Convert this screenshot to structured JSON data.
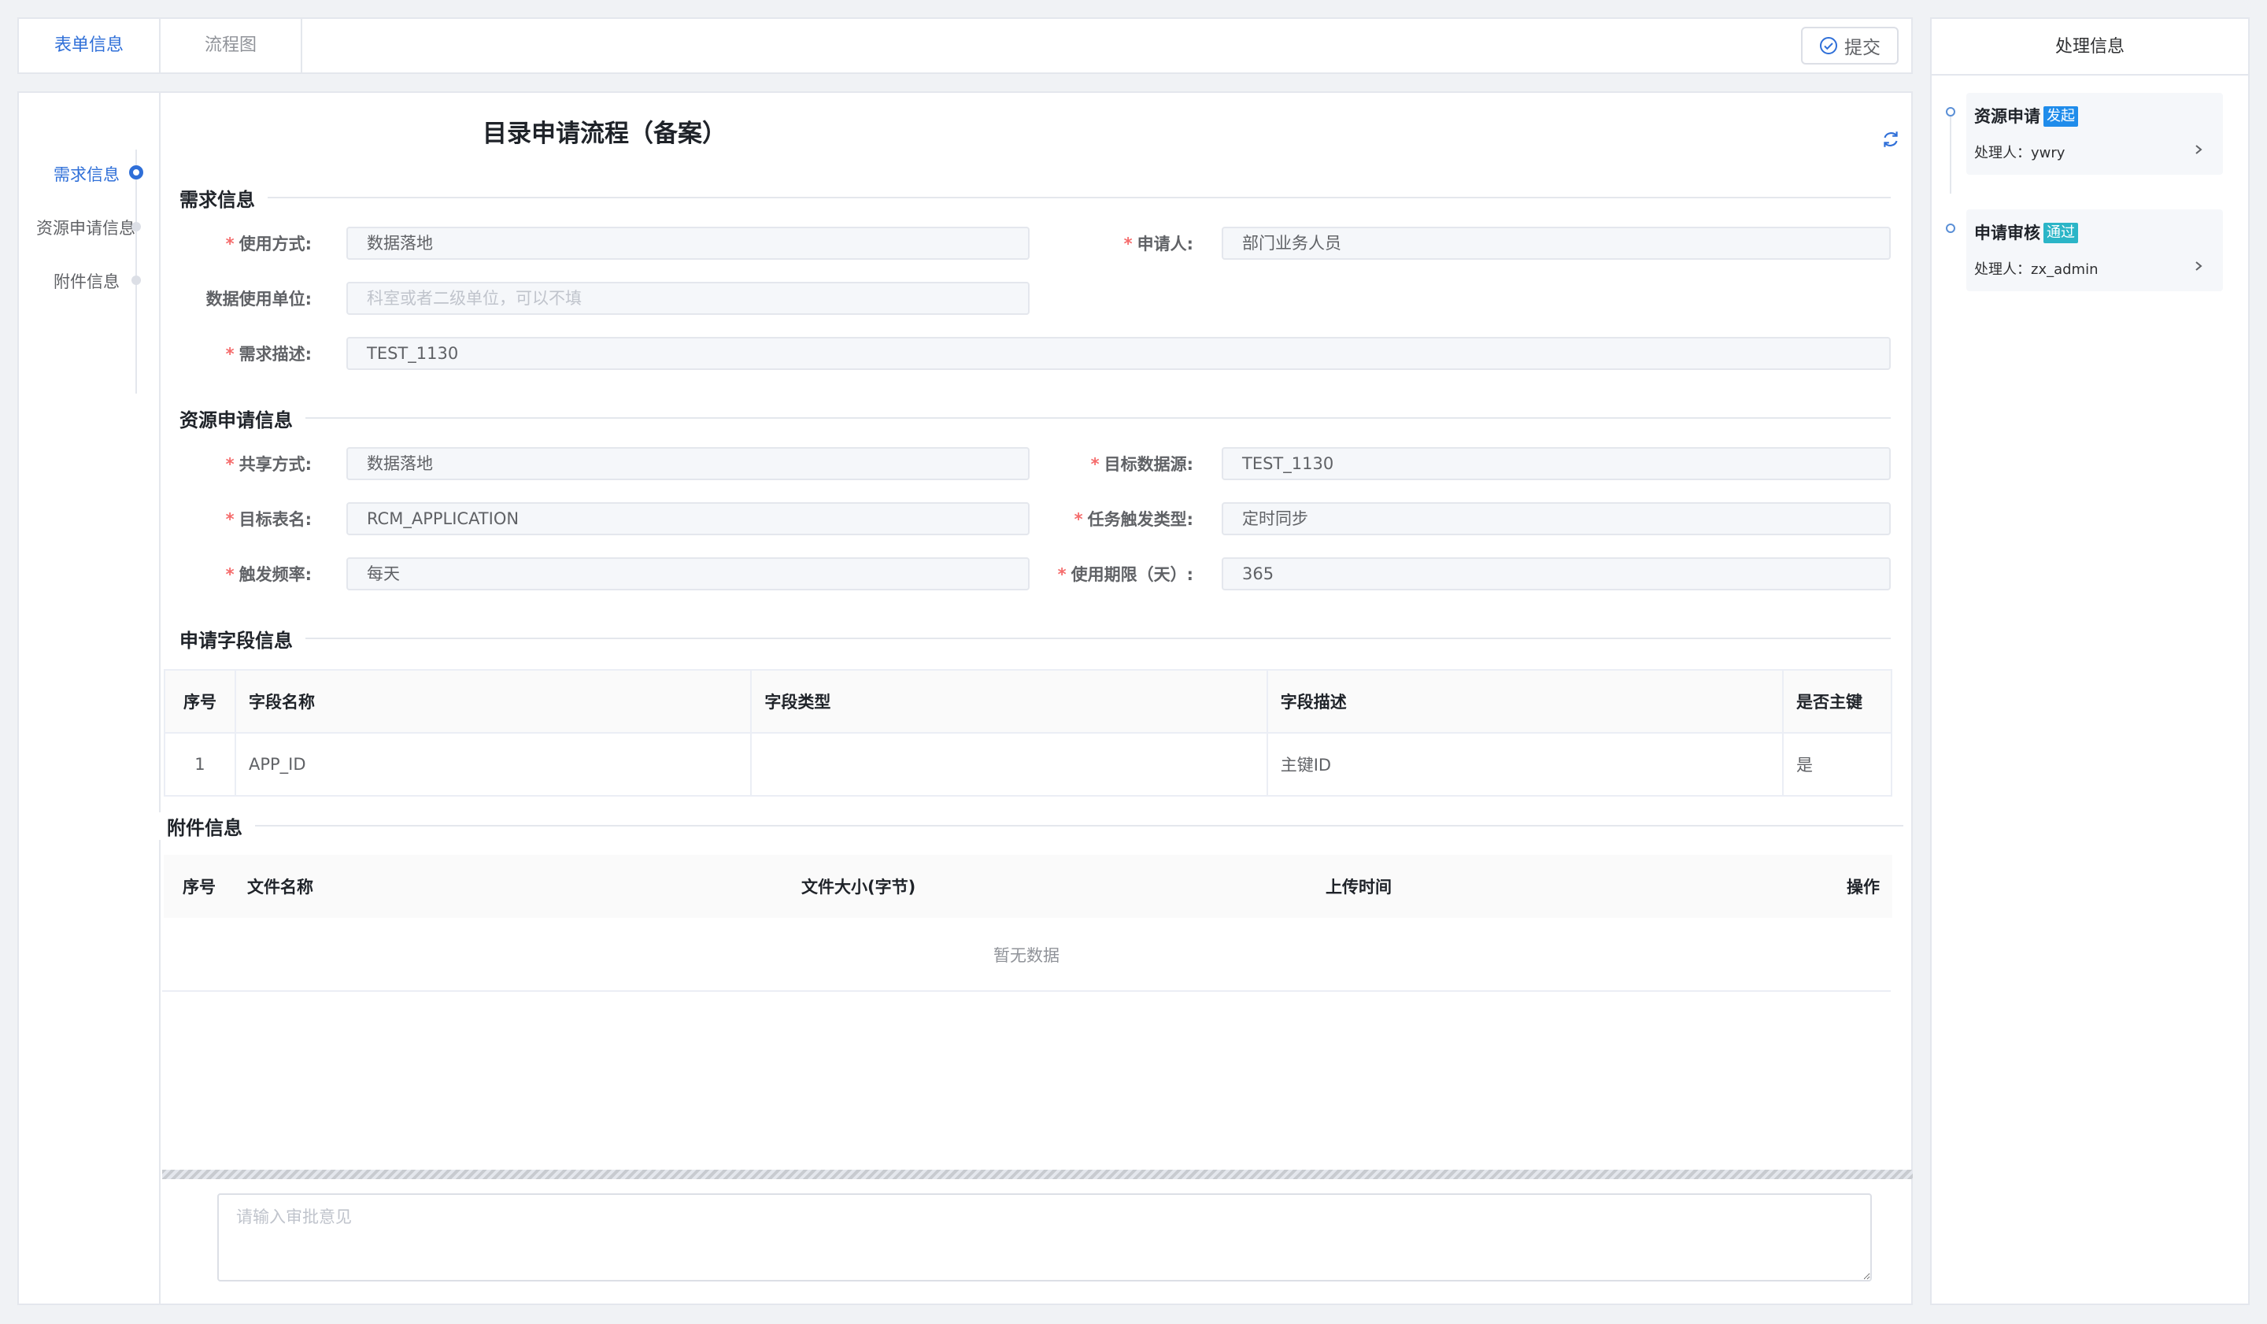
{
  "tabs": [
    {
      "label": "表单信息",
      "active": true
    },
    {
      "label": "流程图",
      "active": false
    }
  ],
  "toolbar": {
    "submit_label": "提交",
    "submit_icon": "check-circle-icon"
  },
  "anchors": [
    {
      "label": "需求信息",
      "active": true
    },
    {
      "label": "资源申请信息",
      "active": false
    },
    {
      "label": "附件信息",
      "active": false
    }
  ],
  "form": {
    "title": "目录申请流程（备案）",
    "sections": {
      "demand": "需求信息",
      "resource": "资源申请信息",
      "fields": "申请字段信息",
      "attachments": "附件信息"
    },
    "demand": {
      "usage_mode": {
        "label": "使用方式:",
        "value": "数据落地",
        "required": true
      },
      "applicant": {
        "label": "申请人:",
        "value": "部门业务人员",
        "required": true
      },
      "using_unit": {
        "label": "数据使用单位:",
        "placeholder": "科室或者二级单位，可以不填",
        "required": false
      },
      "description": {
        "label": "需求描述:",
        "value": "TEST_1130",
        "required": true
      }
    },
    "resource": {
      "share_mode": {
        "label": "共享方式:",
        "value": "数据落地"
      },
      "target_datasource": {
        "label": "目标数据源:",
        "value": "TEST_1130"
      },
      "target_table": {
        "label": "目标表名:",
        "value": "RCM_APPLICATION"
      },
      "trigger_type": {
        "label": "任务触发类型:",
        "value": "定时同步"
      },
      "trigger_freq": {
        "label": "触发频率:",
        "value": "每天"
      },
      "usage_period": {
        "label": "使用期限（天）:",
        "value": "365"
      }
    },
    "field_table": {
      "headers": [
        "序号",
        "字段名称",
        "字段类型",
        "字段描述",
        "是否主键"
      ],
      "rows": [
        [
          "1",
          "APP_ID",
          "",
          "主键ID",
          "是"
        ]
      ]
    },
    "attachment_table": {
      "headers": [
        "序号",
        "文件名称",
        "文件大小(字节)",
        "上传时间",
        "操作"
      ],
      "empty_text": "暂无数据"
    },
    "opinion_placeholder": "请输入审批意见"
  },
  "side": {
    "title": "处理信息",
    "steps": [
      {
        "title": "资源申请",
        "badge": "发起",
        "badge_color": "#1f8ceb",
        "handler": "处理人：ywry"
      },
      {
        "title": "申请审核",
        "badge": "通过",
        "badge_color": "#2bb5c7",
        "handler": "处理人：zx_admin"
      }
    ]
  },
  "colors": {
    "accent": "#2f6fd8",
    "required": "#f56c6c"
  }
}
